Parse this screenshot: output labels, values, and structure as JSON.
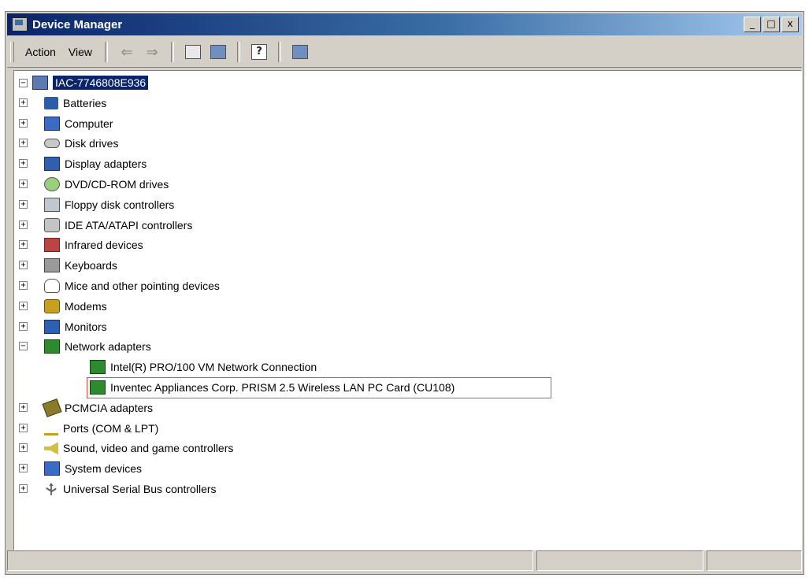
{
  "window": {
    "title": "Device Manager",
    "controls": {
      "minimize": "_",
      "maximize": "□",
      "close": "x"
    }
  },
  "menu": {
    "action": "Action",
    "view": "View"
  },
  "toolbar": {
    "icons": [
      "back-arrow-icon",
      "forward-arrow-icon",
      "properties-icon",
      "show-hide-tree-icon",
      "help-icon",
      "scan-hardware-icon"
    ],
    "arrows": {
      "back": "⇐",
      "forward": "⇒"
    },
    "help_glyph": "?"
  },
  "tree": {
    "root": {
      "label": "IAC-7746808E936",
      "expander": "−"
    },
    "categories": [
      {
        "label": "Batteries",
        "icon": "battery-icon",
        "expander": "+"
      },
      {
        "label": "Computer",
        "icon": "computer-icon",
        "expander": "+"
      },
      {
        "label": "Disk drives",
        "icon": "disk-drive-icon",
        "expander": "+"
      },
      {
        "label": "Display adapters",
        "icon": "display-adapter-icon",
        "expander": "+"
      },
      {
        "label": "DVD/CD-ROM drives",
        "icon": "dvd-drive-icon",
        "expander": "+"
      },
      {
        "label": "Floppy disk controllers",
        "icon": "floppy-controller-icon",
        "expander": "+"
      },
      {
        "label": "IDE ATA/ATAPI controllers",
        "icon": "ide-controller-icon",
        "expander": "+"
      },
      {
        "label": "Infrared devices",
        "icon": "infrared-icon",
        "expander": "+"
      },
      {
        "label": "Keyboards",
        "icon": "keyboard-icon",
        "expander": "+"
      },
      {
        "label": "Mice and other pointing devices",
        "icon": "mouse-icon",
        "expander": "+"
      },
      {
        "label": "Modems",
        "icon": "modem-icon",
        "expander": "+"
      },
      {
        "label": "Monitors",
        "icon": "monitor-icon",
        "expander": "+"
      },
      {
        "label": "Network adapters",
        "icon": "network-adapter-icon",
        "expander": "−",
        "children": [
          {
            "label": "Intel(R) PRO/100 VM Network Connection",
            "icon": "network-card-icon"
          },
          {
            "label": "Inventec Appliances Corp. PRISM 2.5 Wireless LAN PC Card (CU108)",
            "icon": "network-card-icon",
            "highlighted": true
          }
        ]
      },
      {
        "label": "PCMCIA adapters",
        "icon": "pcmcia-icon",
        "expander": "+"
      },
      {
        "label": "Ports (COM & LPT)",
        "icon": "ports-icon",
        "expander": "+"
      },
      {
        "label": "Sound, video and game controllers",
        "icon": "sound-icon",
        "expander": "+"
      },
      {
        "label": "System devices",
        "icon": "system-devices-icon",
        "expander": "+"
      },
      {
        "label": "Universal Serial Bus controllers",
        "icon": "usb-icon",
        "expander": "+"
      }
    ]
  },
  "colors": {
    "titlebar_start": "#0a246a",
    "selection": "#0a246a",
    "highlight_box": "#e05050"
  }
}
